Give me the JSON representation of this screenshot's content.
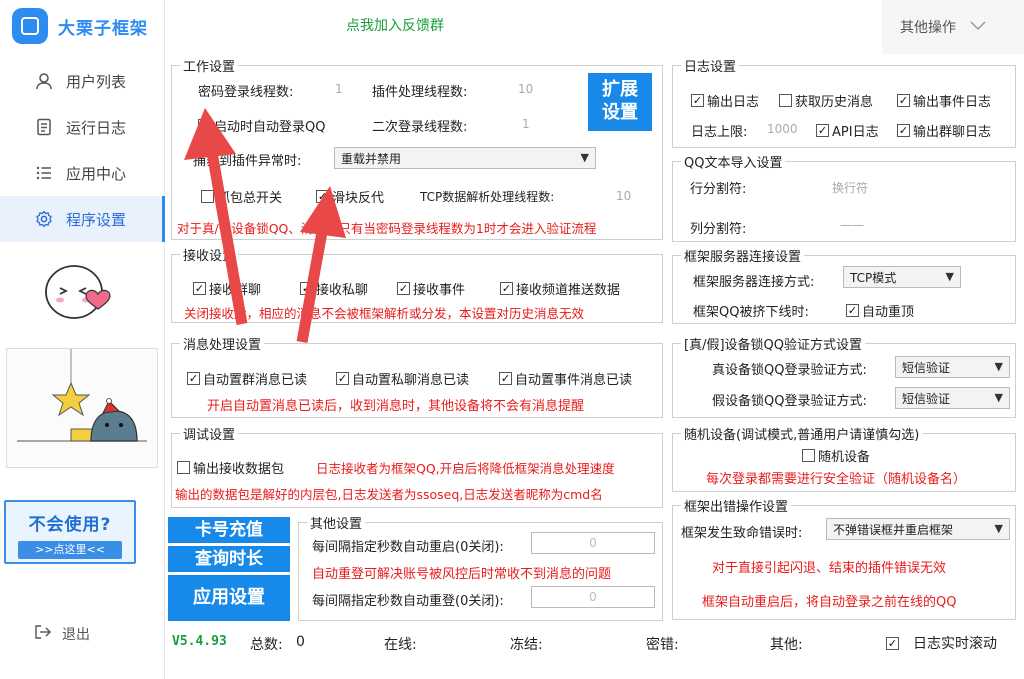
{
  "app": {
    "title": "大栗子框架"
  },
  "sidebar": {
    "items": [
      {
        "label": "用户列表",
        "icon": "user-icon"
      },
      {
        "label": "运行日志",
        "icon": "document-icon"
      },
      {
        "label": "应用中心",
        "icon": "list-icon"
      },
      {
        "label": "程序设置",
        "icon": "gear-icon",
        "active": true
      }
    ],
    "help": {
      "title": "不会使用?",
      "button": ">>点这里<<"
    },
    "logout": "退出"
  },
  "topbar": {
    "join_link": "点我加入反馈群",
    "other_ops": "其他操作"
  },
  "work": {
    "legend": "工作设置",
    "pwd_threads_label": "密码登录线程数:",
    "pwd_threads_value": "1",
    "plugin_threads_label": "插件处理线程数:",
    "plugin_threads_value": "10",
    "auto_login": "启动时自动登录QQ",
    "second_threads_label": "二次登录线程数:",
    "second_threads_value": "1",
    "plugin_error_label": "捕获到插件异常时:",
    "plugin_error_value": "重载并禁用",
    "capture_switch": "抓包总开关",
    "slider": "滑块反代",
    "tcp_threads_label": "TCP数据解析处理线程数:",
    "tcp_threads_value": "10",
    "note": "对于真/假设备锁QQ、滑块，只有当密码登录线程数为1时才会进入验证流程",
    "expand_button": [
      "扩展",
      "设置"
    ]
  },
  "receive": {
    "legend": "接收设置",
    "items": [
      "接收群聊",
      "接收私聊",
      "接收事件",
      "接收频道推送数据"
    ],
    "note": "关闭接收后，相应的消息不会被框架解析或分发，本设置对历史消息无效"
  },
  "message": {
    "legend": "消息处理设置",
    "items": [
      "自动置群消息已读",
      "自动置私聊消息已读",
      "自动置事件消息已读"
    ],
    "note": "开启自动置消息已读后，收到消息时，其他设备将不会有消息提醒"
  },
  "debug": {
    "legend": "调试设置",
    "output_label": "输出接收数据包",
    "note1": "日志接收者为框架QQ,开启后将降低框架消息处理速度",
    "note2": "输出的数据包是解好的内层包,日志发送者为ssoseq,日志发送者昵称为cmd名"
  },
  "buttons": {
    "recharge": "卡号充值",
    "query": "查询时长",
    "apply": "应用设置"
  },
  "other": {
    "legend": "其他设置",
    "restart_label": "每间隔指定秒数自动重启(0关闭):",
    "restart_value": "0",
    "note": "自动重登可解决账号被风控后时常收不到消息的问题",
    "relogin_label": "每间隔指定秒数自动重登(0关闭):",
    "relogin_value": "0"
  },
  "log": {
    "legend": "日志设置",
    "output_log": "输出日志",
    "fetch_history": "获取历史消息",
    "event_log": "输出事件日志",
    "limit_label": "日志上限:",
    "limit_value": "1000",
    "api_log": "API日志",
    "group_log": "输出群聊日志"
  },
  "qqtext": {
    "legend": "QQ文本导入设置",
    "row_sep_label": "行分割符:",
    "row_sep_value": "换行符",
    "col_sep_label": "列分割符:",
    "col_sep_value": "——"
  },
  "server": {
    "legend": "框架服务器连接设置",
    "mode_label": "框架服务器连接方式:",
    "mode_value": "TCP模式",
    "kicked_label": "框架QQ被挤下线时:",
    "auto_relogin": "自动重顶"
  },
  "devlock": {
    "legend": "[真/假]设备锁QQ验证方式设置",
    "real_label": "真设备锁QQ登录验证方式:",
    "real_value": "短信验证",
    "fake_label": "假设备锁QQ登录验证方式:",
    "fake_value": "短信验证"
  },
  "random": {
    "legend": "随机设备(调试模式,普通用户请谨慎勾选)",
    "label": "随机设备",
    "note": "每次登录都需要进行安全验证（随机设备名）"
  },
  "error": {
    "legend": "框架出错操作设置",
    "fatal_label": "框架发生致命错误时:",
    "fatal_value": "不弹错误框并重启框架",
    "note1": "对于直接引起闪退、结束的插件错误无效",
    "note2": "框架自动重启后，将自动登录之前在线的QQ"
  },
  "status": {
    "version": "V5.4.93",
    "total_label": "总数:",
    "total_value": "0",
    "online_label": "在线:",
    "frozen_label": "冻结:",
    "pwd_error_label": "密错:",
    "other_label": "其他:",
    "realtime_scroll": "日志实时滚动"
  },
  "colors": {
    "accent": "#1789e8",
    "red_note": "#e81c1c",
    "green_link": "#1a9e3a"
  }
}
